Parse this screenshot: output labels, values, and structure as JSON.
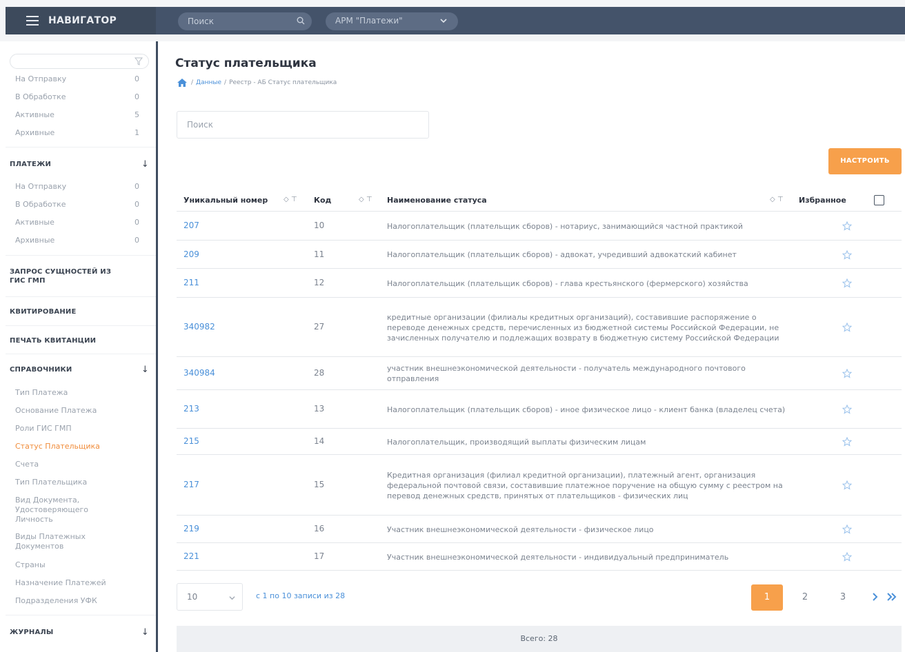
{
  "topbar": {
    "brand": "НАВИГАТОР",
    "search_placeholder": "Поиск",
    "arm_selected": "АРМ \"Платежи\""
  },
  "sidebar": {
    "top_items": [
      {
        "label": "На Отправку",
        "count": "0"
      },
      {
        "label": "В Обработке",
        "count": "0"
      },
      {
        "label": "Активные",
        "count": "5"
      },
      {
        "label": "Архивные",
        "count": "1"
      }
    ],
    "payments": {
      "title": "ПЛАТЕЖИ",
      "items": [
        {
          "label": "На Отправку",
          "count": "0"
        },
        {
          "label": "В Обработке",
          "count": "0"
        },
        {
          "label": "Активные",
          "count": "0"
        },
        {
          "label": "Архивные",
          "count": "0"
        }
      ]
    },
    "request_gis": "ЗАПРОС СУЩНОСТЕЙ ИЗ ГИС ГМП",
    "kvit": "КВИТИРОВАНИЕ",
    "print": "ПЕЧАТЬ КВИТАНЦИИ",
    "refs": {
      "title": "СПРАВОЧНИКИ",
      "items": [
        "Тип Платежа",
        "Основание Платежа",
        "Роли ГИС ГМП",
        "Статус Плательщика",
        "Счета",
        "Тип Плательщика",
        "Вид Документа, Удостоверяющего Личность",
        "Виды Платежных Документов",
        "Страны",
        "Назначение Платежей",
        "Подразделения УФК"
      ]
    },
    "journals": "ЖУРНАЛЫ"
  },
  "main": {
    "title": "Статус плательщика",
    "breadcrumb": [
      "Данные",
      "Реестр - АБ Статус плательщика"
    ],
    "search_placeholder": "Поиск",
    "configure_button": "НАСТРОИТЬ",
    "columns": {
      "number": "Уникальный номер",
      "code": "Код",
      "name": "Наименование статуса",
      "favorite": "Избранное"
    },
    "rows": [
      {
        "number": "207",
        "code": "10",
        "name": "Налогоплательщик (плательщик сборов) - нотариус, занимающийся частной практикой"
      },
      {
        "number": "209",
        "code": "11",
        "name": "Налогоплательщик (плательщик сборов) - адвокат, учредивший адвокатский кабинет"
      },
      {
        "number": "211",
        "code": "12",
        "name": "Налогоплательщик (плательщик сборов) - глава крестьянского (фермерского) хозяйства"
      },
      {
        "number": "340982",
        "code": "27",
        "name": "кредитные организации (филиалы кредитных организаций), составившие распоряжение о переводе денежных средств, перечисленных из бюджетной системы Российской Федерации, не зачисленных получателю и подлежащих возврату в бюджетную систему Российской Федерации"
      },
      {
        "number": "340984",
        "code": "28",
        "name": "участник внешнеэкономической деятельности - получатель международного почтового отправления"
      },
      {
        "number": "213",
        "code": "13",
        "name": "Налогоплательщик (плательщик сборов) - иное физическое лицо - клиент банка (владелец счета)"
      },
      {
        "number": "215",
        "code": "14",
        "name": "Налогоплательщик, производящий выплаты физическим лицам"
      },
      {
        "number": "217",
        "code": "15",
        "name": "Кредитная организация (филиал кредитной организации), платежный агент, организация федеральной почтовой связи, составившие платежное поручение на общую сумму с реестром на перевод денежных средств, принятых от плательщиков - физических лиц"
      },
      {
        "number": "219",
        "code": "16",
        "name": "Участник внешнеэкономической деятельности - физическое лицо"
      },
      {
        "number": "221",
        "code": "17",
        "name": "Участник внешнеэкономической деятельности - индивидуальный предприниматель"
      }
    ],
    "page_size": "10",
    "records_info": "с 1 по 10 записи из 28",
    "pages": [
      "1",
      "2",
      "3"
    ],
    "total": "Всего: 28"
  },
  "colors": {
    "accent": "#f7a04b",
    "link": "#4a90d9",
    "topbar": "#44536a"
  }
}
